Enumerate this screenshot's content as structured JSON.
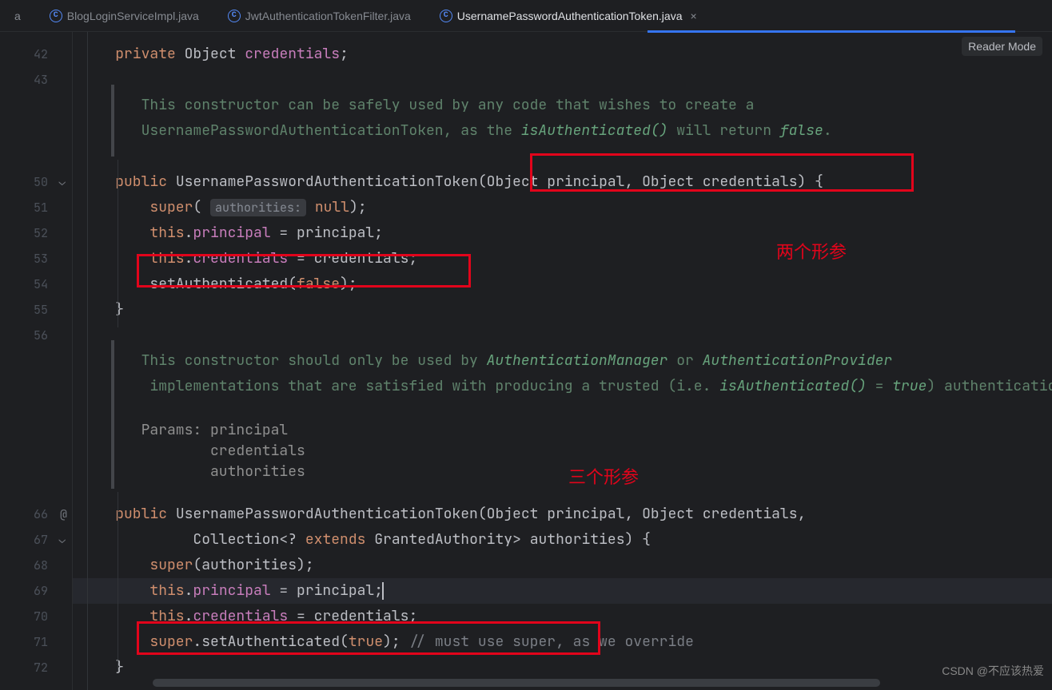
{
  "tabs": {
    "t0_suffix": "a",
    "t1": "BlogLoginServiceImpl.java",
    "t2": "JwtAuthenticationTokenFilter.java",
    "t3": "UsernamePasswordAuthenticationToken.java"
  },
  "reader_mode": "Reader Mode",
  "gutter": {
    "l42": "42",
    "l43": "43",
    "l50": "50",
    "l51": "51",
    "l52": "52",
    "l53": "53",
    "l54": "54",
    "l55": "55",
    "l56": "56",
    "l66": "66",
    "l67": "67",
    "l68": "68",
    "l69": "69",
    "l70": "70",
    "l71": "71",
    "l72": "72"
  },
  "code": {
    "l42": {
      "kw": "private",
      "sp": " ",
      "typ": "Object",
      "sp2": " ",
      "fld": "credentials",
      "end": ";"
    },
    "doc1a": "This constructor can be safely used by any code that wishes to create a ",
    "doc1b": "UsernamePasswordAuthenticationToken",
    "doc1c": ", as the ",
    "doc1d": "isAuthenticated()",
    "doc1e": " will return ",
    "doc1f": "false",
    "doc1g": ".",
    "l50": {
      "kw": "public",
      "sp": " ",
      "mth": "UsernamePasswordAuthenticationToken",
      "open": "(",
      "p1t": "Object",
      "sp1": " ",
      "p1n": "principal",
      "c": ",",
      "sp2": " ",
      "p2t": "Object",
      "sp3": " ",
      "p2n": "credentials",
      "close": ")",
      "sp4": " ",
      "brace": "{"
    },
    "l51": {
      "kw": "super",
      "open": "(",
      "hint": "authorities:",
      "sp": " ",
      "val": "null",
      "close": ")",
      "end": ";"
    },
    "l52": {
      "kw": "this",
      "dot": ".",
      "fld": "principal",
      "sp": " = ",
      "var": "principal",
      "end": ";"
    },
    "l53": {
      "kw": "this",
      "dot": ".",
      "fld": "credentials",
      "sp": " = ",
      "var": "credentials",
      "end": ";"
    },
    "l54": {
      "mth": "setAuthenticated",
      "open": "(",
      "val": "false",
      "close": ")",
      "end": ";"
    },
    "l55": {
      "brace": "}"
    },
    "doc2a": "This constructor should only be used by ",
    "doc2b": "AuthenticationManager",
    "doc2c": " or ",
    "doc2d": "AuthenticationProvider",
    "doc2e": " implementations that are satisfied with producing a trusted (i.e. ",
    "doc2f": "isAuthenticated()",
    "doc2g": " = ",
    "doc2h": "true",
    "doc2i": ") authentication token.",
    "params_label": "Params:",
    "param1": "principal",
    "param2": "credentials",
    "param3": "authorities",
    "l66": {
      "kw": "public",
      "sp": " ",
      "mth": "UsernamePasswordAuthenticationToken",
      "open": "(",
      "p1t": "Object",
      "sp1": " ",
      "p1n": "principal",
      "c": ",",
      "sp2": " ",
      "p2t": "Object",
      "sp3": " ",
      "p2n": "credentials",
      "c2": ","
    },
    "l67": {
      "p3a": "Collection",
      "open": "<",
      "q": "?",
      "sp": " ",
      "kw": "extends",
      "sp2": " ",
      "p3b": "GrantedAuthority",
      "close": ">",
      "sp3": " ",
      "p3n": "authorities",
      "cparen": ")",
      "sp4": " ",
      "brace": "{"
    },
    "l68": {
      "kw": "super",
      "open": "(",
      "var": "authorities",
      "close": ")",
      "end": ";"
    },
    "l69": {
      "kw": "this",
      "dot": ".",
      "fld": "principal",
      "sp": " = ",
      "var": "principal",
      "end": ";"
    },
    "l70": {
      "kw": "this",
      "dot": ".",
      "fld": "credentials",
      "sp": " = ",
      "var": "credentials",
      "end": ";"
    },
    "l71": {
      "kw": "super",
      "dot": ".",
      "mth": "setAuthenticated",
      "open": "(",
      "val": "true",
      "close": ")",
      "end": ";",
      "sp": " ",
      "cmt": "// must use super, as we override"
    },
    "l72": {
      "brace": "}"
    }
  },
  "annotations": {
    "a1": "两个形参",
    "a2": "三个形参"
  },
  "watermark": "CSDN @不应该热爱"
}
